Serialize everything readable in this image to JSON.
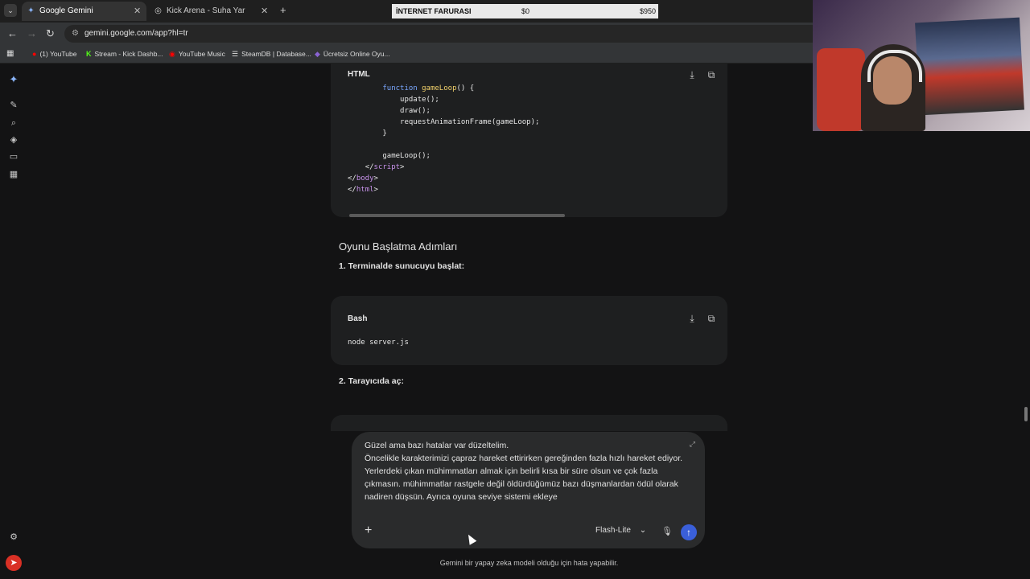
{
  "browser": {
    "tabs": [
      {
        "title": "Google Gemini",
        "icon": "gemini-icon",
        "active": true
      },
      {
        "title": "Kick Arena - Suha Yar",
        "icon": "globe-icon",
        "active": false
      }
    ],
    "url": "gemini.google.com/app?hl=tr",
    "bookmarks": [
      {
        "label": "(1) YouTube",
        "icon": "youtube-icon",
        "color": "#ff0000"
      },
      {
        "label": "Stream - Kick Dashb...",
        "icon": "kick-icon",
        "color": "#53fc18"
      },
      {
        "label": "YouTube Music",
        "icon": "youtube-music-icon",
        "color": "#ff0000"
      },
      {
        "label": "SteamDB | Database...",
        "icon": "steamdb-icon",
        "color": "#ffffff"
      },
      {
        "label": "Ücretsiz Online Oyu...",
        "icon": "game-icon",
        "color": "#8a63d2"
      }
    ]
  },
  "ticker": {
    "label": "İNTERNET FARURASI",
    "current": "$0",
    "goal": "$950"
  },
  "code_card_1": {
    "lang": "HTML",
    "lines": [
      {
        "indent": "        ",
        "parts": [
          [
            "kw",
            "function"
          ],
          [
            "",
            ""
          ],
          [
            "fn",
            " gameLoop"
          ],
          [
            "",
            "() {"
          ]
        ]
      },
      {
        "indent": "            ",
        "parts": [
          [
            "",
            "update();"
          ]
        ]
      },
      {
        "indent": "            ",
        "parts": [
          [
            "",
            "draw();"
          ]
        ]
      },
      {
        "indent": "            ",
        "parts": [
          [
            "",
            "requestAnimationFrame(gameLoop);"
          ]
        ]
      },
      {
        "indent": "        ",
        "parts": [
          [
            "",
            "}"
          ]
        ]
      },
      {
        "indent": "",
        "parts": [
          [
            "",
            ""
          ]
        ]
      },
      {
        "indent": "        ",
        "parts": [
          [
            "",
            "gameLoop();"
          ]
        ]
      },
      {
        "indent": "    ",
        "parts": [
          [
            "",
            "</"
          ],
          [
            "tag",
            "script"
          ],
          [
            "",
            ">"
          ]
        ]
      },
      {
        "indent": "",
        "parts": [
          [
            "",
            "</"
          ],
          [
            "tag",
            "body"
          ],
          [
            "",
            ">"
          ]
        ]
      },
      {
        "indent": "",
        "parts": [
          [
            "",
            "</"
          ],
          [
            "tag",
            "html"
          ],
          [
            "",
            ">"
          ]
        ]
      }
    ]
  },
  "section_title": "Oyunu Başlatma Adımları",
  "step1": "1. Terminalde sunucuyu başlat:",
  "code_card_2": {
    "lang": "Bash",
    "code": "node server.js"
  },
  "step2": "2. Tarayıcıda aç:",
  "prompt": {
    "text": "Güzel ama bazı hatalar var düzeltelim.\nÖncelikle karakterimizi çapraz hareket ettirirken gereğinden fazla hızlı hareket ediyor.\nYerlerdeki çıkan mühimmatları almak için belirli kısa bir süre olsun ve çok fazla çıkmasın. mühimmatlar rastgele değil öldürdüğümüz bazı düşmanlardan ödül olarak nadiren düşsün. Ayrıca oyuna seviye sistemi ekleye",
    "model": "Flash-Lite"
  },
  "disclaimer": "Gemini bir yapay zeka modeli olduğu için hata yapabilir."
}
